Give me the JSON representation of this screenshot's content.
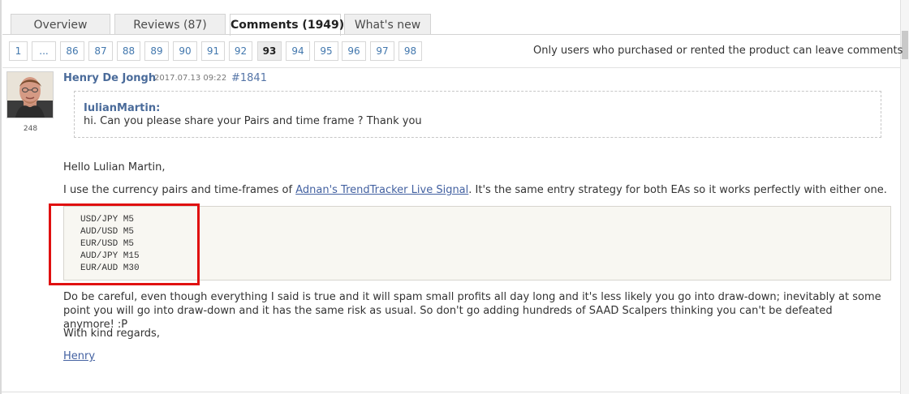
{
  "tabs": {
    "overview": "Overview",
    "reviews": "Reviews (87)",
    "comments": "Comments (1949)",
    "whats_new": "What's new"
  },
  "pagination": {
    "pages": [
      "1",
      "...",
      "86",
      "87",
      "88",
      "89",
      "90",
      "91",
      "92",
      "93",
      "94",
      "95",
      "96",
      "97",
      "98"
    ],
    "current": "93"
  },
  "notice": "Only users who purchased or rented the product can leave comments",
  "comment": {
    "author": "Henry De Jongh",
    "rating": "248",
    "date": "2017.07.13 09:22",
    "id": "#1841",
    "quote": {
      "author": "IulianMartin:",
      "text": "hi. Can you please share your Pairs and time frame ? Thank you"
    },
    "greeting": "Hello Lulian Martin,",
    "intro_before_link": "I use the currency pairs and time-frames of ",
    "link_text": "Adnan's TrendTracker Live Signal",
    "intro_after_link": ". It's the same entry strategy for both EAs so it works perfectly with either one.",
    "code_lines": [
      "USD/JPY M5",
      "AUD/USD M5",
      "EUR/USD M5",
      "AUD/JPY M15",
      "EUR/AUD M30"
    ],
    "warning": "Do be careful, even though everything I said is true and it will spam small profits all day long and it's less likely you go into draw-down; inevitably at some point you will go into draw-down and it has the same risk as usual. So don't go adding hundreds of SAAD Scalpers thinking you can't be defeated anymore! :P",
    "closing": "With kind regards,",
    "signature": "Henry"
  },
  "colors": {
    "link": "#4361a1",
    "tab_active_bg": "#ffffff",
    "tab_inactive_bg": "#efefef",
    "code_background": "#f8f7f2",
    "highlight": "#e01010"
  },
  "icons": {
    "avatar": "user-avatar-icon"
  }
}
